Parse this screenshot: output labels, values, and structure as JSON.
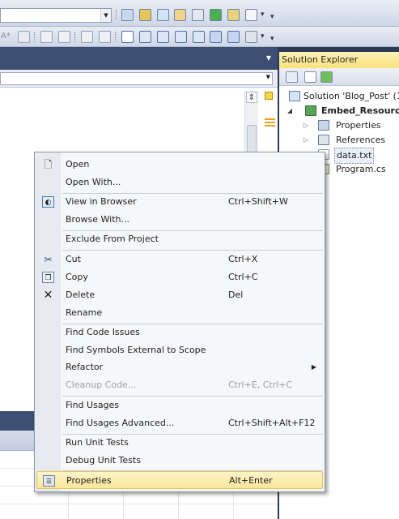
{
  "colors": {
    "ide_frame": "#2b3a55",
    "solution_explorer_title_bg": "#fbe27c",
    "menu_hover_bg": "#fbe69a",
    "menu_hover_border": "#e5c365"
  },
  "solution_explorer": {
    "title": "Solution Explorer",
    "tree": {
      "solution": "Solution 'Blog_Post' (1",
      "project": "Embed_Resource",
      "properties": "Properties",
      "references": "References",
      "data_file": "data.txt",
      "program_file": "Program.cs"
    }
  },
  "context_menu": {
    "items": [
      {
        "label": "Open",
        "shortcut": "",
        "icon": "open-file-icon"
      },
      {
        "label": "Open With...",
        "shortcut": ""
      },
      {
        "label": "View in Browser",
        "shortcut": "Ctrl+Shift+W",
        "icon": "browser-icon"
      },
      {
        "label": "Browse With...",
        "shortcut": ""
      },
      {
        "label": "Exclude From Project",
        "shortcut": ""
      },
      {
        "label": "Cut",
        "shortcut": "Ctrl+X",
        "icon": "scissors-icon"
      },
      {
        "label": "Copy",
        "shortcut": "Ctrl+C",
        "icon": "copy-icon"
      },
      {
        "label": "Delete",
        "shortcut": "Del",
        "icon": "delete-x-icon"
      },
      {
        "label": "Rename",
        "shortcut": ""
      },
      {
        "label": "Find Code Issues",
        "shortcut": ""
      },
      {
        "label": "Find Symbols External to Scope",
        "shortcut": ""
      },
      {
        "label": "Refactor",
        "shortcut": "",
        "submenu": true
      },
      {
        "label": "Cleanup Code...",
        "shortcut": "Ctrl+E, Ctrl+C",
        "disabled": true
      },
      {
        "label": "Find Usages",
        "shortcut": ""
      },
      {
        "label": "Find Usages Advanced...",
        "shortcut": "Ctrl+Shift+Alt+F12"
      },
      {
        "label": "Run Unit Tests",
        "shortcut": ""
      },
      {
        "label": "Debug Unit Tests",
        "shortcut": ""
      },
      {
        "label": "Properties",
        "shortcut": "Alt+Enter",
        "icon": "properties-icon",
        "highlighted": true
      }
    ]
  },
  "toolbar": {
    "formatting_font_label": "A*"
  }
}
